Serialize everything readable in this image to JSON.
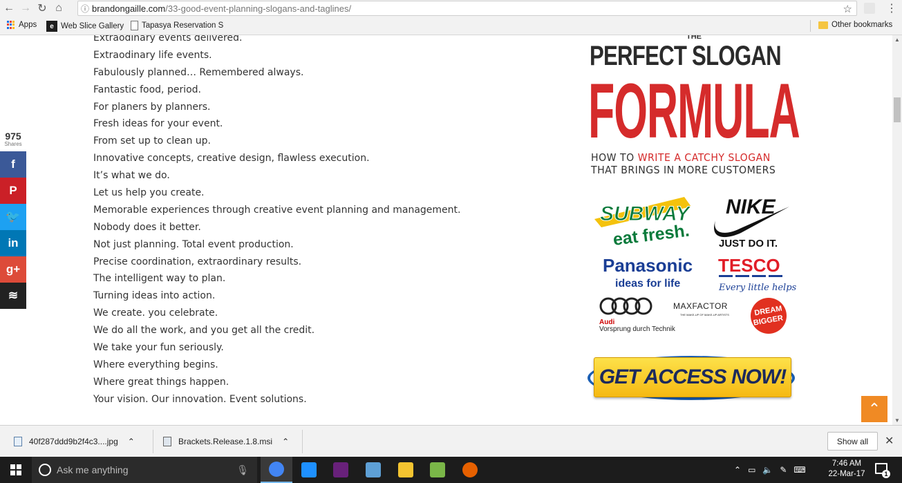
{
  "browser": {
    "url_host": "brandongaille.com",
    "url_path": "/33-good-event-planning-slogans-and-taglines/",
    "bookmarks": [
      {
        "label": "Apps",
        "icon": "apps-grid-icon"
      },
      {
        "label": "Web Slice Gallery",
        "icon": "ie-icon"
      },
      {
        "label": "Tapasya Reservation S",
        "icon": "page-icon"
      }
    ],
    "other_bookmarks": "Other bookmarks"
  },
  "share_bar": {
    "count": "975",
    "count_label": "Shares",
    "buttons": [
      {
        "network": "facebook",
        "glyph": "f",
        "color": "#3b5998"
      },
      {
        "network": "pinterest",
        "glyph": "P",
        "color": "#cb2027"
      },
      {
        "network": "twitter",
        "glyph": "🐦",
        "color": "#1da1f2"
      },
      {
        "network": "linkedin",
        "glyph": "in",
        "color": "#0077b5"
      },
      {
        "network": "googleplus",
        "glyph": "g+",
        "color": "#dd4b39"
      },
      {
        "network": "buffer",
        "glyph": "≋",
        "color": "#222222"
      }
    ]
  },
  "slogans": [
    "Extraodinary events delivered.",
    "Extraodinary life events.",
    "Fabulously planned… Remembered always.",
    "Fantastic food, period.",
    "For planers by planners.",
    "Fresh ideas for your event.",
    "From set up to clean up.",
    "Innovative concepts, creative design, flawless execution.",
    "It’s what we do.",
    "Let us help you create.",
    "Memorable experiences through creative event planning and management.",
    "Nobody does it better.",
    "Not just planning. Total event production.",
    "Precise coordination, extraordinary results.",
    "The intelligent way to plan.",
    "Turning ideas into action.",
    "We create. you celebrate.",
    "We do all the work, and you get all the credit.",
    "We take your fun seriously.",
    "Where everything begins.",
    "Where great things happen.",
    "Your vision. Our innovation. Event solutions."
  ],
  "ad": {
    "the": "THE",
    "perfect_slogan": "PERFECT SLOGAN",
    "formula": "FORMULA",
    "how_to": "HOW TO",
    "write_catchy": "WRITE A CATCHY SLOGAN",
    "brings": "THAT BRINGS IN MORE CUSTOMERS",
    "logos": {
      "subway": "SUBWAY",
      "subway_tag": "eat fresh.",
      "nike": "NIKE",
      "nike_tag": "JUST DO IT.",
      "panasonic": "Panasonic",
      "panasonic_tag": "ideas for life",
      "tesco": "TESCO",
      "tesco_tag": "Every little helps",
      "audi": "Audi",
      "audi_tag": "Vorsprung durch Technik",
      "maxfactor": "MAXFACTOR",
      "maxfactor_tag": "THE MAKE-UP OF MAKE-UP ARTISTS",
      "dream1": "DREAM",
      "dream2": "BIGGER"
    },
    "cta": "GET ACCESS NOW!"
  },
  "downloads": {
    "items": [
      {
        "name": "40f287ddd9b2f4c3....jpg"
      },
      {
        "name": "Brackets.Release.1.8.msi"
      }
    ],
    "show_all": "Show all"
  },
  "taskbar": {
    "search_placeholder": "Ask me anything",
    "time": "7:46 AM",
    "date": "22-Mar-17",
    "notification_count": "1",
    "apps": [
      {
        "name": "chrome",
        "color": "#4285f4"
      },
      {
        "name": "edge",
        "color": "#1e90ff"
      },
      {
        "name": "visual-studio",
        "color": "#68217a"
      },
      {
        "name": "virtualbox",
        "color": "#5ea0d6"
      },
      {
        "name": "file-explorer",
        "color": "#f4c430"
      },
      {
        "name": "notepad-plus",
        "color": "#7ab648"
      },
      {
        "name": "firefox",
        "color": "#e66000"
      }
    ]
  }
}
